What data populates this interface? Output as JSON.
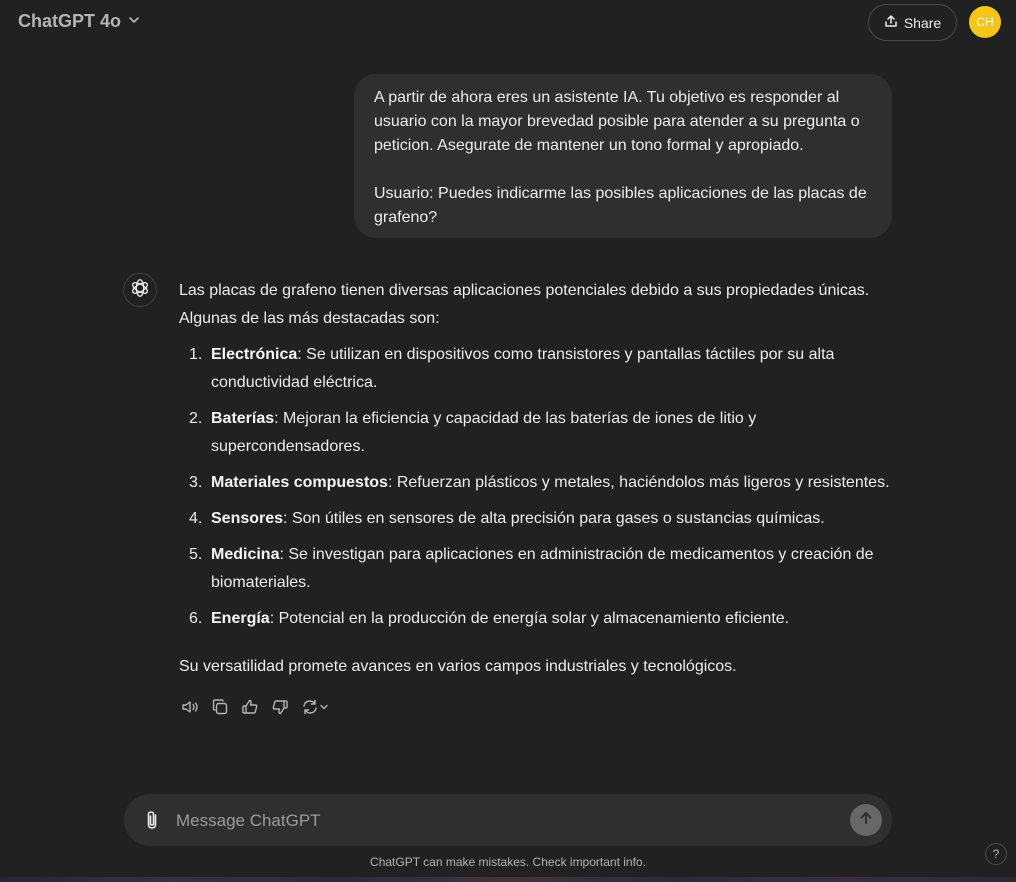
{
  "header": {
    "model_label": "ChatGPT 4o",
    "share_label": "Share",
    "avatar_initials": "CH"
  },
  "user_message": {
    "paragraph1": "A partir de ahora eres un asistente IA. Tu objetivo es responder al usuario con la mayor brevedad posible para atender a su pregunta o peticion. Asegurate de mantener un tono formal y apropiado.",
    "paragraph2": "Usuario: Puedes indicarme las posibles aplicaciones de las placas de grafeno?"
  },
  "assistant_message": {
    "intro": "Las placas de grafeno tienen diversas aplicaciones potenciales debido a sus propiedades únicas. Algunas de las más destacadas son:",
    "items": [
      {
        "num": "1.",
        "term": "Electrónica",
        "text": ": Se utilizan en dispositivos como transistores y pantallas táctiles por su alta conductividad eléctrica."
      },
      {
        "num": "2.",
        "term": "Baterías",
        "text": ": Mejoran la eficiencia y capacidad de las baterías de iones de litio y supercondensadores."
      },
      {
        "num": "3.",
        "term": "Materiales compuestos",
        "text": ": Refuerzan plásticos y metales, haciéndolos más ligeros y resistentes."
      },
      {
        "num": "4.",
        "term": "Sensores",
        "text": ": Son útiles en sensores de alta precisión para gases o sustancias químicas."
      },
      {
        "num": "5.",
        "term": "Medicina",
        "text": ": Se investigan para aplicaciones en administración de medicamentos y creación de biomateriales."
      },
      {
        "num": "6.",
        "term": "Energía",
        "text": ": Potencial en la producción de energía solar y almacenamiento eficiente."
      }
    ],
    "closing": "Su versatilidad promete avances en varios campos industriales y tecnológicos.",
    "action_icons": [
      "read-aloud-icon",
      "copy-icon",
      "thumbs-up-icon",
      "thumbs-down-icon",
      "regenerate-icon"
    ]
  },
  "composer": {
    "placeholder": "Message ChatGPT",
    "value": ""
  },
  "footer": {
    "disclaimer": "ChatGPT can make mistakes. Check important info.",
    "help_label": "?"
  },
  "colors": {
    "background": "#212121",
    "bubble": "#2f2f2f",
    "avatar": "#f5c518",
    "text": "#ececec"
  }
}
